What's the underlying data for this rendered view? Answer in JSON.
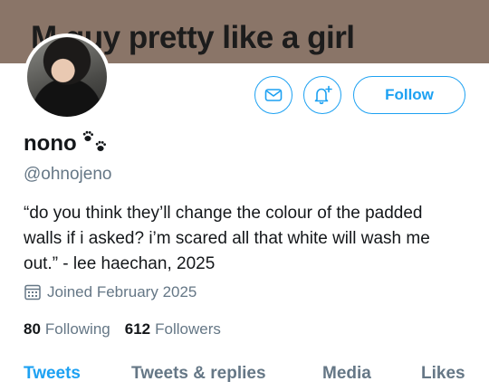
{
  "header": {
    "text": "M guy pretty like a girl"
  },
  "profile": {
    "display_name": "nono",
    "handle": "@ohnojeno",
    "bio": "“do you think they’ll change the colour of the padded walls if i asked? i’m scared all that white will wash me out.” - lee haechan, 2025",
    "joined": "Joined February 2025",
    "following_count": "80",
    "following_label": "Following",
    "followers_count": "612",
    "followers_label": "Followers"
  },
  "actions": {
    "message_icon": "mail-icon",
    "notify_icon": "bell-plus-icon",
    "follow_label": "Follow"
  },
  "tabs": [
    {
      "label": "Tweets",
      "active": true
    },
    {
      "label": "Tweets & replies",
      "active": false
    },
    {
      "label": "Media",
      "active": false
    },
    {
      "label": "Likes",
      "active": false
    }
  ],
  "colors": {
    "accent": "#1da1f2",
    "header_bg": "#8a7568",
    "muted": "#657786"
  }
}
